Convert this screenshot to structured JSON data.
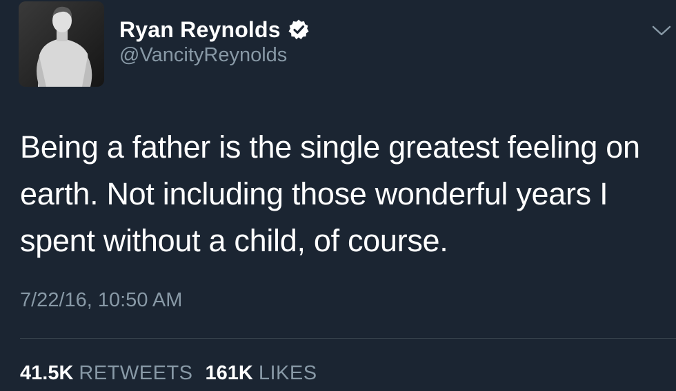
{
  "profile": {
    "display_name": "Ryan Reynolds",
    "handle": "@VancityReynolds",
    "avatar_icon": "profile-photo",
    "verified_icon": "verified-badge-icon"
  },
  "tweet": {
    "text": "Being a father is the single greatest feeling on earth. Not including those wonderful years I spent without a child, of course.",
    "timestamp": "7/22/16, 10:50 AM"
  },
  "stats": {
    "retweets_count": "41.5K",
    "retweets_label": "RETWEETS",
    "likes_count": "161K",
    "likes_label": "LIKES"
  },
  "colors": {
    "background": "#1b2532",
    "secondary_text": "#8899a6",
    "primary_text": "#ffffff"
  }
}
